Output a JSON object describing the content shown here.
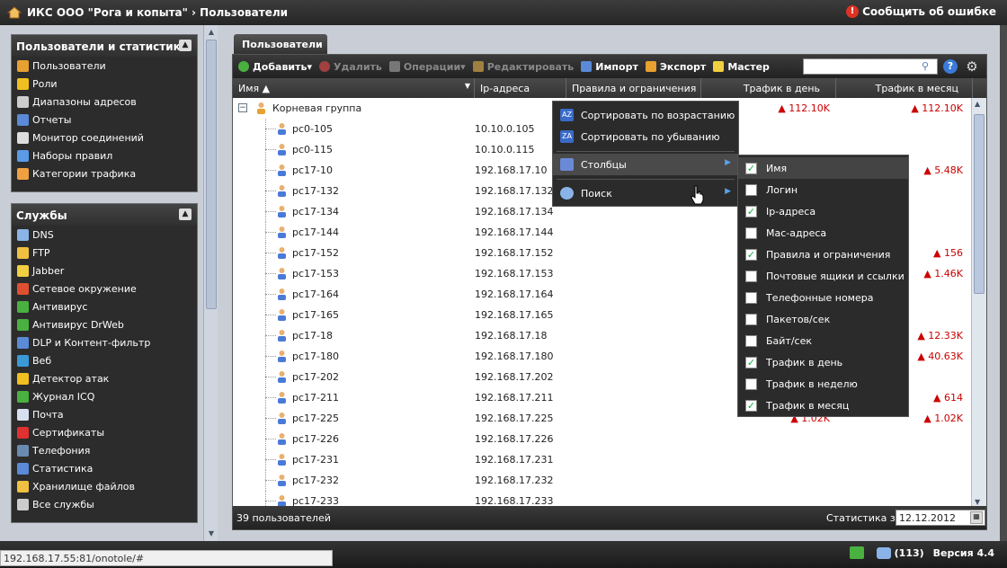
{
  "app": {
    "title": "ИКС ООО \"Рога и копыта\" › Пользователи",
    "report": "Сообщить об ошибке"
  },
  "sidebar": {
    "panel1": {
      "title": "Пользователи и статистика",
      "items": [
        {
          "label": "Пользователи",
          "icon": "users-icon",
          "color": "#e8a030"
        },
        {
          "label": "Роли",
          "icon": "key-icon",
          "color": "#f0c020"
        },
        {
          "label": "Диапазоны адресов",
          "icon": "document-icon",
          "color": "#ccc"
        },
        {
          "label": "Отчеты",
          "icon": "chart-icon",
          "color": "#5a8ad8"
        },
        {
          "label": "Монитор соединений",
          "icon": "magnifier-icon",
          "color": "#ddd"
        },
        {
          "label": "Наборы правил",
          "icon": "rules-icon",
          "color": "#5a9ae8"
        },
        {
          "label": "Категории трафика",
          "icon": "book-icon",
          "color": "#f0a040"
        }
      ]
    },
    "panel2": {
      "title": "Службы",
      "items": [
        {
          "label": "DNS",
          "icon": "tag-icon",
          "color": "#8ab4e8"
        },
        {
          "label": "FTP",
          "icon": "folder-icon",
          "color": "#f0c040"
        },
        {
          "label": "Jabber",
          "icon": "bulb-icon",
          "color": "#f0d040"
        },
        {
          "label": "Сетевое окружение",
          "icon": "windows-icon",
          "color": "#e05030"
        },
        {
          "label": "Антивирус",
          "icon": "bug-icon",
          "color": "#4ab040"
        },
        {
          "label": "Антивирус DrWeb",
          "icon": "spider-icon",
          "color": "#4ab040"
        },
        {
          "label": "DLP и Контент-фильтр",
          "icon": "eye-icon",
          "color": "#5a8ad8"
        },
        {
          "label": "Веб",
          "icon": "globe-icon",
          "color": "#3a9ad8"
        },
        {
          "label": "Детектор атак",
          "icon": "alarm-icon",
          "color": "#f0c020"
        },
        {
          "label": "Журнал ICQ",
          "icon": "flower-icon",
          "color": "#4ab040"
        },
        {
          "label": "Почта",
          "icon": "mail-icon",
          "color": "#d8e0f0"
        },
        {
          "label": "Сертификаты",
          "icon": "ribbon-icon",
          "color": "#e03030"
        },
        {
          "label": "Телефония",
          "icon": "phone-icon",
          "color": "#6a8ab0"
        },
        {
          "label": "Статистика",
          "icon": "stats-icon",
          "color": "#5a8ad8"
        },
        {
          "label": "Хранилище файлов",
          "icon": "folder-icon",
          "color": "#f0c040"
        },
        {
          "label": "Все службы",
          "icon": "gears-icon",
          "color": "#ccc"
        }
      ]
    }
  },
  "tab": "Пользователи",
  "toolbar": {
    "add": "Добавить",
    "delete": "Удалить",
    "operations": "Операции",
    "edit": "Редактировать",
    "import": "Импорт",
    "export": "Экспорт",
    "wizard": "Мастер",
    "search_placeholder": ""
  },
  "columns": {
    "name": "Имя",
    "ip": "Ip-адреса",
    "rules": "Правила и ограничения",
    "day": "Трафик в день",
    "month": "Трафик в месяц"
  },
  "root": {
    "label": "Корневая группа",
    "day": "112.10K",
    "month": "112.10K"
  },
  "rows": [
    {
      "name": "pc0-105",
      "ip": "10.10.0.105",
      "day": "",
      "month": ""
    },
    {
      "name": "pc0-115",
      "ip": "10.10.0.115",
      "day": "",
      "month": ""
    },
    {
      "name": "pc17-10",
      "ip": "192.168.17.10",
      "day": "",
      "month": "5.48K"
    },
    {
      "name": "pc17-132",
      "ip": "192.168.17.132",
      "day": "",
      "month": ""
    },
    {
      "name": "pc17-134",
      "ip": "192.168.17.134",
      "day": "",
      "month": ""
    },
    {
      "name": "pc17-144",
      "ip": "192.168.17.144",
      "day": "",
      "month": ""
    },
    {
      "name": "pc17-152",
      "ip": "192.168.17.152",
      "day": "",
      "month": "156"
    },
    {
      "name": "pc17-153",
      "ip": "192.168.17.153",
      "day": "",
      "month": "1.46K"
    },
    {
      "name": "pc17-164",
      "ip": "192.168.17.164",
      "day": "",
      "month": ""
    },
    {
      "name": "pc17-165",
      "ip": "192.168.17.165",
      "day": "",
      "month": ""
    },
    {
      "name": "pc17-18",
      "ip": "192.168.17.18",
      "day": "",
      "month": "12.33K"
    },
    {
      "name": "pc17-180",
      "ip": "192.168.17.180",
      "day": "",
      "month": "40.63K"
    },
    {
      "name": "pc17-202",
      "ip": "192.168.17.202",
      "day": "",
      "month": ""
    },
    {
      "name": "pc17-211",
      "ip": "192.168.17.211",
      "day": "",
      "month": "614"
    },
    {
      "name": "pc17-225",
      "ip": "192.168.17.225",
      "day": "1.02K",
      "month": "1.02K"
    },
    {
      "name": "pc17-226",
      "ip": "192.168.17.226",
      "day": "",
      "month": ""
    },
    {
      "name": "pc17-231",
      "ip": "192.168.17.231",
      "day": "",
      "month": ""
    },
    {
      "name": "pc17-232",
      "ip": "192.168.17.232",
      "day": "",
      "month": ""
    },
    {
      "name": "pc17-233",
      "ip": "192.168.17.233",
      "day": "",
      "month": ""
    }
  ],
  "context_menu": {
    "sort_asc": "Сортировать по возрастанию",
    "sort_desc": "Сортировать по убыванию",
    "columns": "Столбцы",
    "search": "Поиск"
  },
  "columns_menu": [
    {
      "label": "Имя",
      "checked": true
    },
    {
      "label": "Логин",
      "checked": false
    },
    {
      "label": "Ip-адреса",
      "checked": true
    },
    {
      "label": "Mac-адреса",
      "checked": false
    },
    {
      "label": "Правила и ограничения",
      "checked": true
    },
    {
      "label": "Почтовые ящики и ссылки",
      "checked": false
    },
    {
      "label": "Телефонные номера",
      "checked": false
    },
    {
      "label": "Пакетов/сек",
      "checked": false
    },
    {
      "label": "Байт/сек",
      "checked": false
    },
    {
      "label": "Трафик в день",
      "checked": true
    },
    {
      "label": "Трафик в неделю",
      "checked": false
    },
    {
      "label": "Трафик в месяц",
      "checked": true
    }
  ],
  "footer": {
    "count": "39 пользователей",
    "stats_label": "Статистика за",
    "date": "12.12.2012"
  },
  "status": {
    "url": "192.168.17.55:81/onotole/#",
    "messages": "(113)",
    "version": "Версия 4.4"
  }
}
